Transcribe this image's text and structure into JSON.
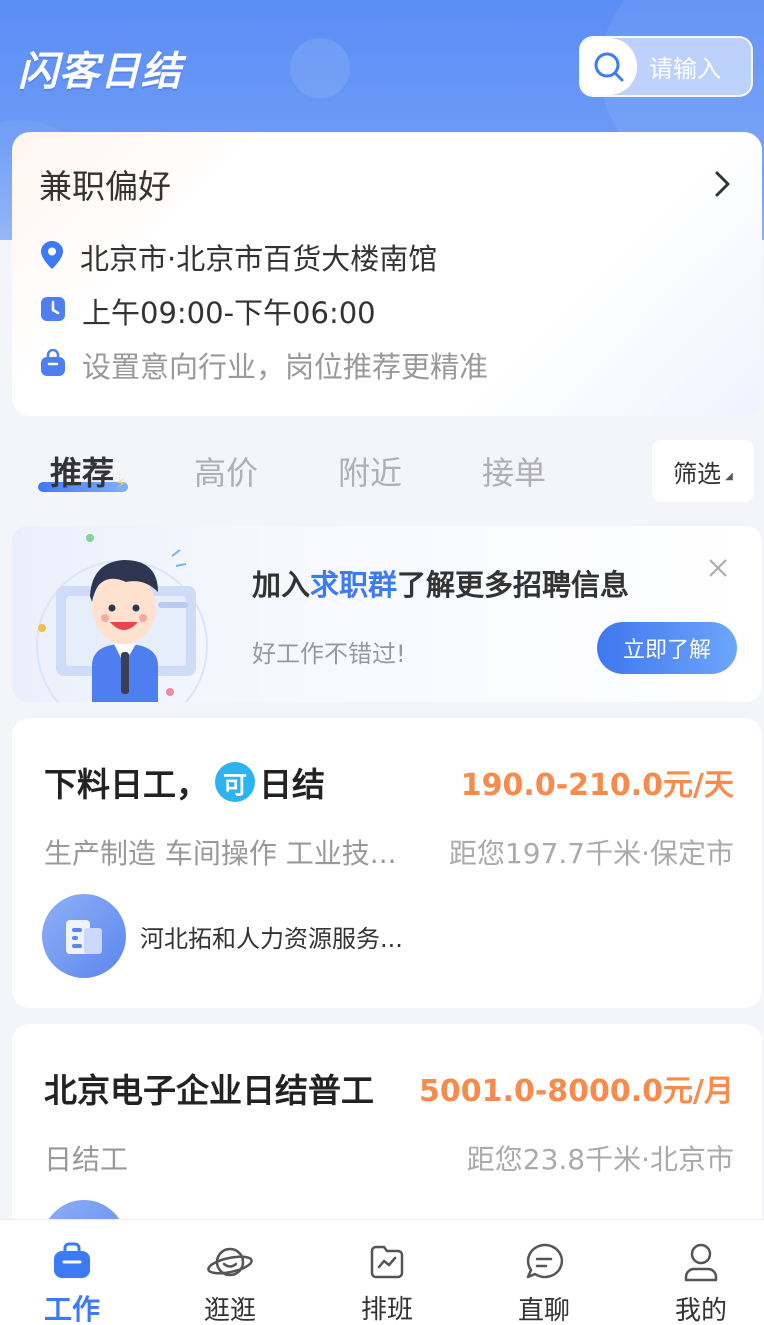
{
  "header": {
    "logo_text": "闪客日结",
    "search_placeholder": "请输入"
  },
  "preference": {
    "title": "兼职偏好",
    "location": "北京市·北京市百货大楼南馆",
    "time": "上午09:00-下午06:00",
    "industry_hint": "设置意向行业，岗位推荐更精准"
  },
  "tabs": [
    {
      "label": "推荐",
      "active": true
    },
    {
      "label": "高价",
      "active": false
    },
    {
      "label": "附近",
      "active": false
    },
    {
      "label": "接单",
      "active": false
    }
  ],
  "filter": {
    "label": "筛选"
  },
  "banner": {
    "title_prefix": "加入",
    "title_highlight": "求职群",
    "title_suffix": "了解更多招聘信息",
    "subtitle": "好工作不错过!",
    "button": "立即了解"
  },
  "jobs": [
    {
      "title": "下料日工，",
      "badge": "可",
      "title_suffix": "日结",
      "salary": "190.0-210.0元/天",
      "tags": "生产制造 车间操作 工业技...",
      "distance": "距您197.7千米·保定市",
      "company": "河北拓和人力资源服务..."
    },
    {
      "title": "北京电子企业日结普工",
      "salary": "5001.0-8000.0元/月",
      "tags": "日结工",
      "distance": "距您23.8千米·北京市"
    }
  ],
  "bottom_nav": [
    {
      "label": "工作",
      "icon": "briefcase-icon",
      "active": true
    },
    {
      "label": "逛逛",
      "icon": "planet-icon",
      "active": false
    },
    {
      "label": "排班",
      "icon": "schedule-icon",
      "active": false
    },
    {
      "label": "直聊",
      "icon": "chat-icon",
      "active": false
    },
    {
      "label": "我的",
      "icon": "user-icon",
      "active": false
    }
  ],
  "colors": {
    "primary": "#3d7af5",
    "salary": "#f78b4b",
    "header_bg": "#5a8df5"
  }
}
